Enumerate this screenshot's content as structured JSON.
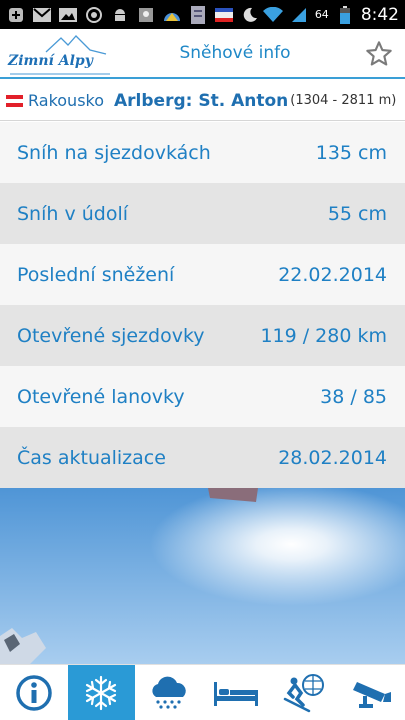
{
  "status_bar": {
    "time": "8:42",
    "battery_percent": "64",
    "icons": [
      "add-icon",
      "gmail-icon",
      "image-icon",
      "sync-icon",
      "android-icon",
      "photo-icon",
      "mountain-app-icon",
      "document-icon",
      "flag-icon",
      "moon-icon",
      "wifi-icon",
      "signal-icon",
      "battery-icon"
    ]
  },
  "header": {
    "logo_text": "Zimní Alpy",
    "title": "Sněhové info",
    "favorite_icon": "star-icon"
  },
  "location": {
    "country": "Rakousko",
    "resort": "Arlberg: St. Anton",
    "altitude": "(1304 - 2811 m)",
    "flag_colors": [
      "#e2202a",
      "#ffffff",
      "#e2202a"
    ]
  },
  "snow_info": [
    {
      "label": "Sníh na sjezdovkách",
      "value": "135 cm"
    },
    {
      "label": "Sníh v údolí",
      "value": "55 cm"
    },
    {
      "label": "Poslední sněžení",
      "value": "22.02.2014"
    },
    {
      "label": "Otevřené sjezdovky",
      "value": "119 / 280 km"
    },
    {
      "label": "Otevřené lanovky",
      "value": "38 / 85"
    },
    {
      "label": "Čas aktualizace",
      "value": "28.02.2014"
    }
  ],
  "bottom_nav": [
    {
      "icon": "info-icon",
      "active": false
    },
    {
      "icon": "snowflake-icon",
      "active": true
    },
    {
      "icon": "weather-snow-icon",
      "active": false
    },
    {
      "icon": "bed-icon",
      "active": false
    },
    {
      "icon": "skier-icon",
      "active": false
    },
    {
      "icon": "webcam-icon",
      "active": false
    }
  ],
  "colors": {
    "accent": "#1f80c4",
    "active_tab": "#2a9ad6",
    "row_alt": "#e4e4e4"
  }
}
